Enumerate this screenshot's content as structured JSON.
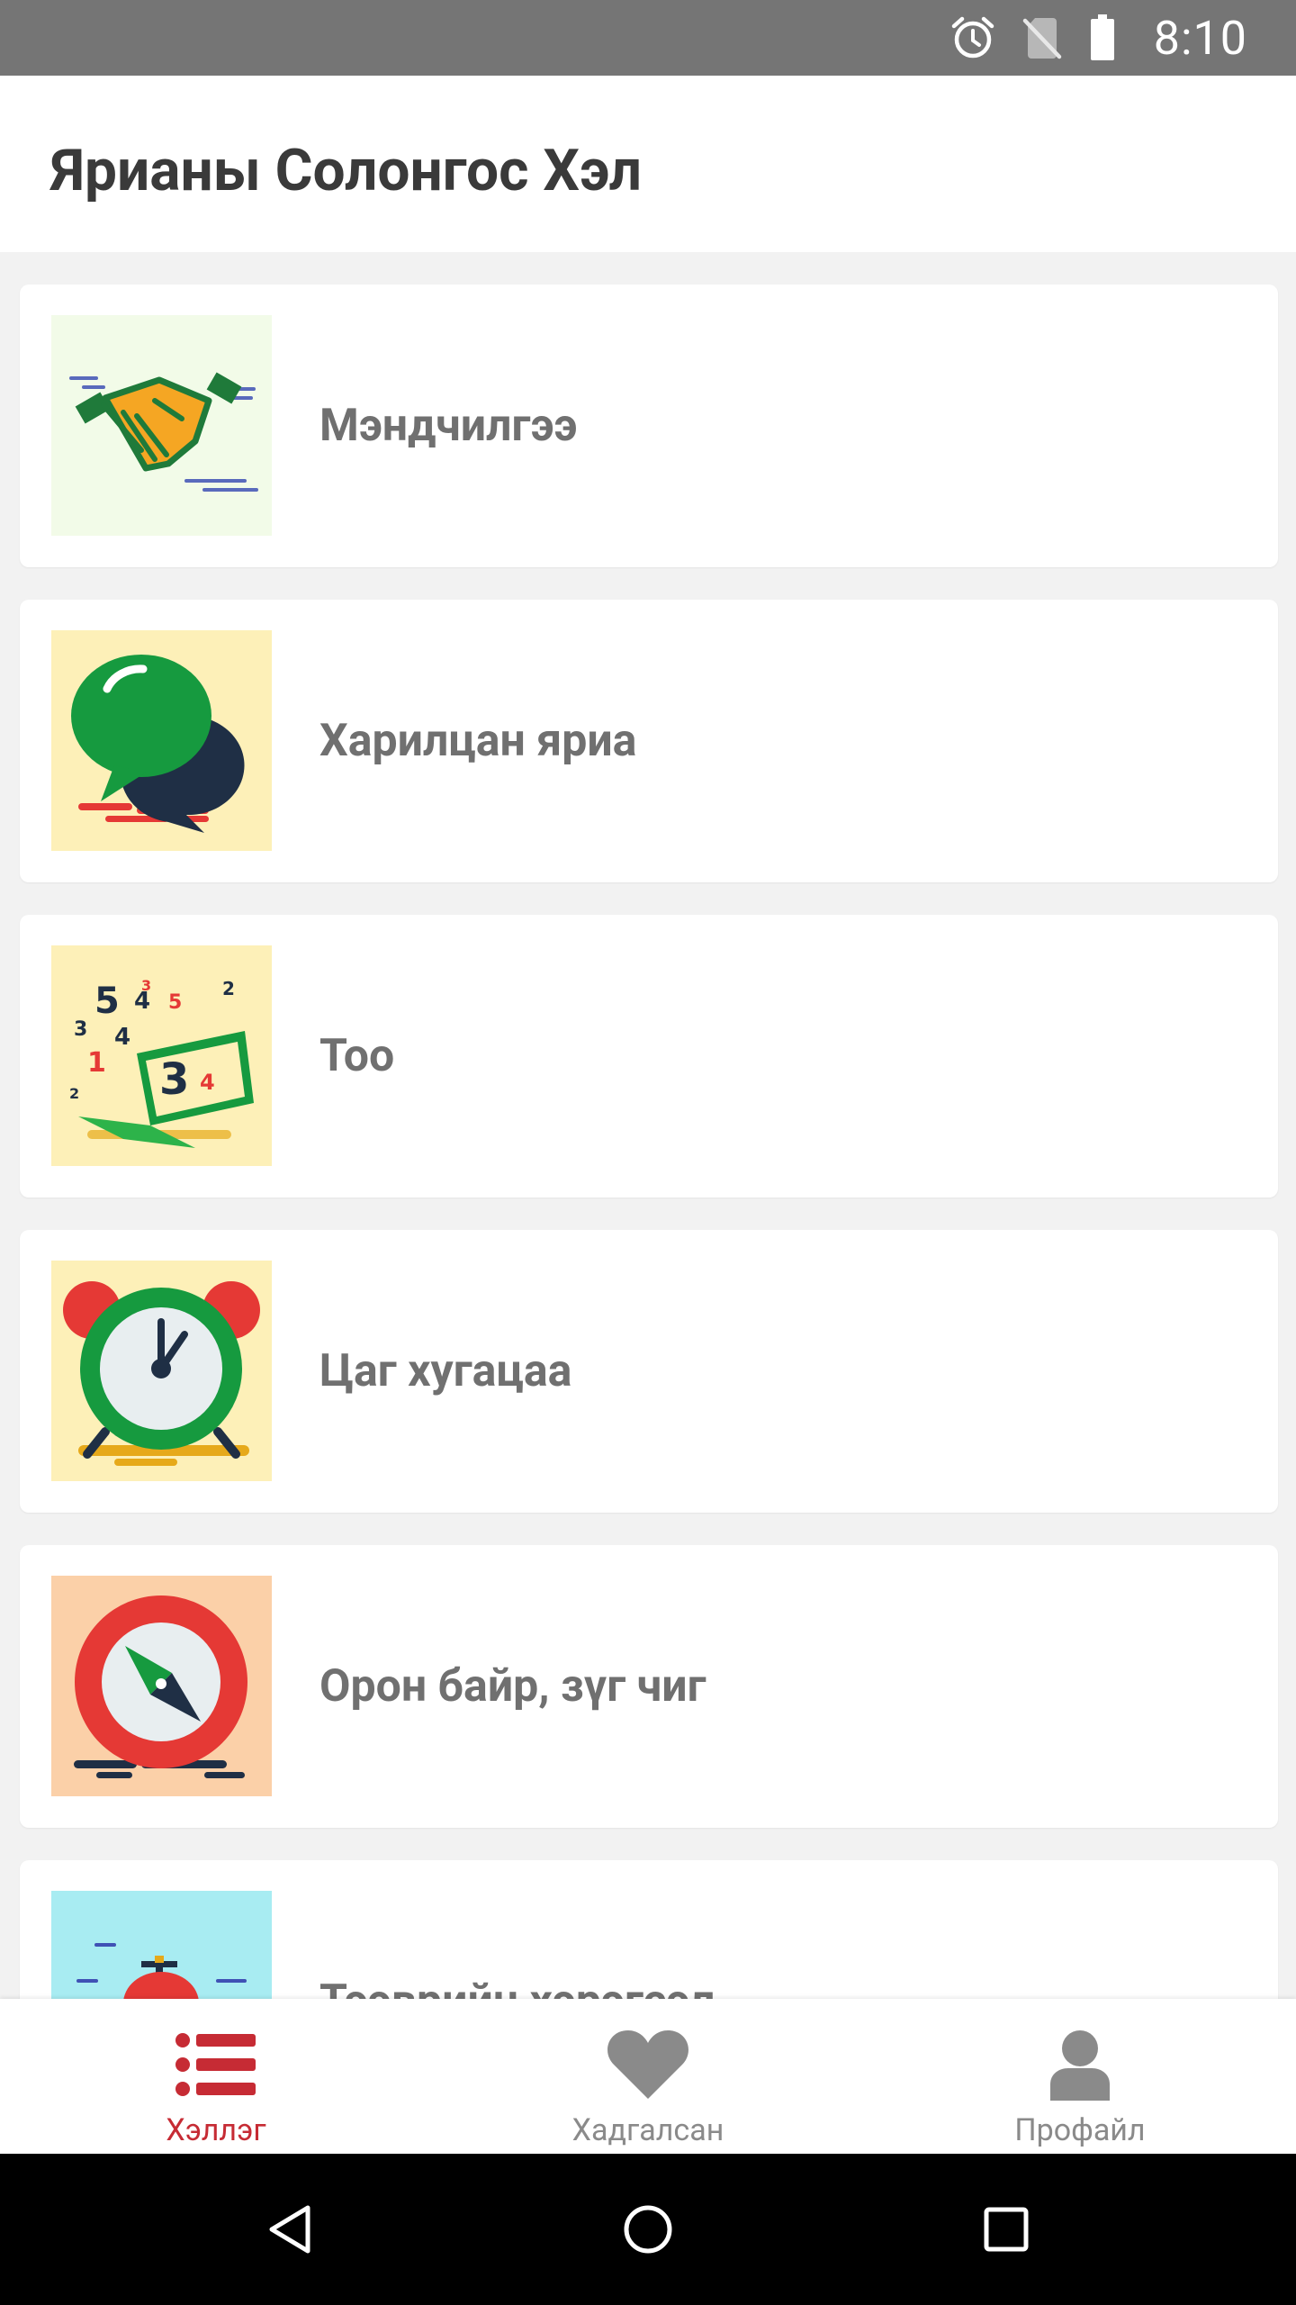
{
  "status_bar": {
    "time": "8:10",
    "icons": [
      "alarm-icon",
      "no-sim-icon",
      "battery-icon"
    ]
  },
  "app_bar": {
    "title": "Ярианы Солонгос Хэл"
  },
  "categories": [
    {
      "label": "Мэндчилгээ",
      "icon": "handshake-icon"
    },
    {
      "label": "Харилцан яриа",
      "icon": "chat-bubbles-icon"
    },
    {
      "label": "Тоо",
      "icon": "numbers-laptop-icon"
    },
    {
      "label": "Цаг хугацаа",
      "icon": "alarm-clock-icon"
    },
    {
      "label": "Орон байр, зүг чиг",
      "icon": "compass-icon"
    },
    {
      "label": "Тээврийн хэрэгсэл",
      "icon": "transport-icon"
    }
  ],
  "bottom_nav": {
    "items": [
      {
        "label": "Хэллэг",
        "icon": "list-icon",
        "active": true
      },
      {
        "label": "Хадгалсан",
        "icon": "heart-icon",
        "active": false
      },
      {
        "label": "Профайл",
        "icon": "person-icon",
        "active": false
      }
    ]
  },
  "colors": {
    "accent": "#c62b34",
    "inactive": "#8a8a8a",
    "status_bar": "#757575",
    "background": "#f2f2f2"
  }
}
